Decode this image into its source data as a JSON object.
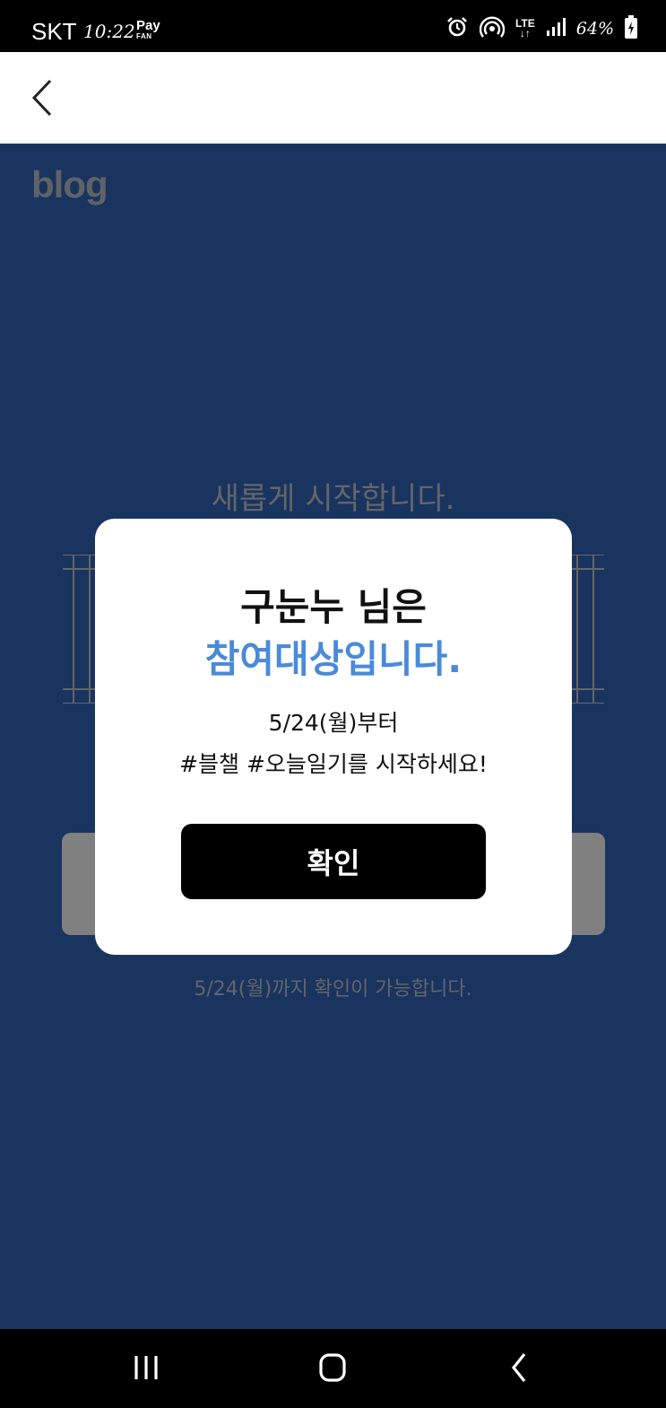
{
  "status_bar": {
    "carrier": "SKT",
    "time": "10:22",
    "pay_label": "Pay",
    "pay_sublabel": "FAN",
    "network": "LTE",
    "battery": "64%"
  },
  "header": {
    "back_icon": "chevron-left-icon"
  },
  "background": {
    "logo": "blog",
    "headline": "새롭게 시작합니다.",
    "note": "5/24(월)까지 확인이 가능합니다."
  },
  "dialog": {
    "title": "구눈누 님은",
    "highlight": "참여대상입니다.",
    "date_line": "5/24(월)부터",
    "text_line": "#블챌 #오늘일기를 시작하세요!",
    "confirm_label": "확인",
    "highlight_color": "#4a8ad8"
  },
  "colors": {
    "main_background": "#1a3460",
    "button": "#000000"
  },
  "nav_bar": {
    "icons": [
      "recents-icon",
      "home-icon",
      "back-icon"
    ]
  }
}
